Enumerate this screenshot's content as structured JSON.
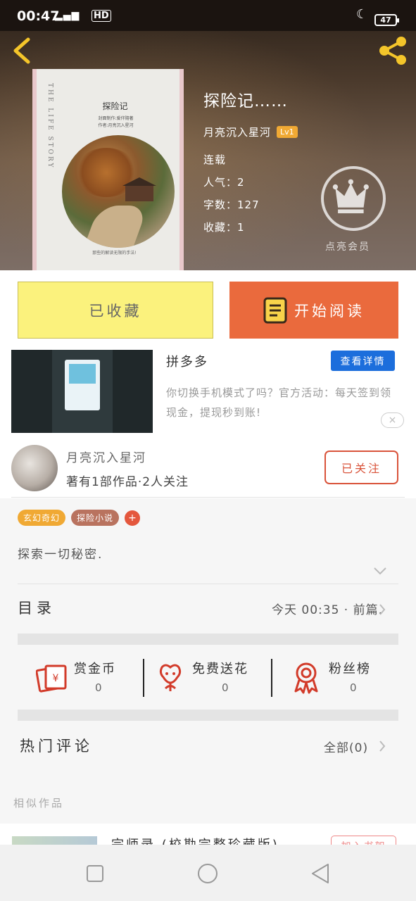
{
  "status_bar": {
    "time": "00:47",
    "signal": "4G",
    "hd": "HD",
    "battery": "47"
  },
  "book": {
    "title": "探险记……",
    "author": "月亮沉入星河",
    "level": "Lv1",
    "status": "连载",
    "popularity": "人气：2",
    "word_count": "字数：127",
    "favorites": "收藏：1",
    "cover": {
      "vertical_text": "THE LIFE STORY",
      "title": "探险记",
      "subtitle_1": "封面制作:爱伴隨著",
      "subtitle_2": "作者:月亮沉入星河",
      "bottom_text": "那些的解读无限的手法!"
    }
  },
  "vip": {
    "label": "点亮会员"
  },
  "actions": {
    "collected_label": "已收藏",
    "read_label": "开始阅读"
  },
  "ad": {
    "title": "拼多多",
    "detail_label": "查看详情",
    "description": "你切换手机模式了吗？官方活动：每天签到领现金，提现秒到账!",
    "close_icon": "×"
  },
  "author_section": {
    "name": "月亮沉入星河",
    "works": "著有1部作品·2人关注",
    "follow_label": "已关注"
  },
  "tags": [
    {
      "label": "玄幻奇幻",
      "color": "#f0a934"
    },
    {
      "label": "探险小说",
      "color": "#b9735f"
    }
  ],
  "tag_add": "+",
  "intro": "探索一切秘密.",
  "catalog": {
    "label": "目录",
    "latest": "今天 00:35 · 前篇."
  },
  "rewards": [
    {
      "label": "赏金币",
      "count": "0",
      "icon": "red-envelope-icon"
    },
    {
      "label": "免费送花",
      "count": "0",
      "icon": "flower-icon"
    },
    {
      "label": "粉丝榜",
      "count": "0",
      "icon": "medal-icon"
    }
  ],
  "comments": {
    "label": "热门评论",
    "all_label": "全部(0)"
  },
  "similar": {
    "label": "相似作品",
    "first_title": "宗师录 (校勘完整珍藏版)",
    "add_label": "加入书架"
  },
  "colors": {
    "accent_orange": "#ea6a3d",
    "collected_yellow": "#fbf27d",
    "detail_blue": "#1c6edc",
    "reward_red": "#d23b2a"
  }
}
